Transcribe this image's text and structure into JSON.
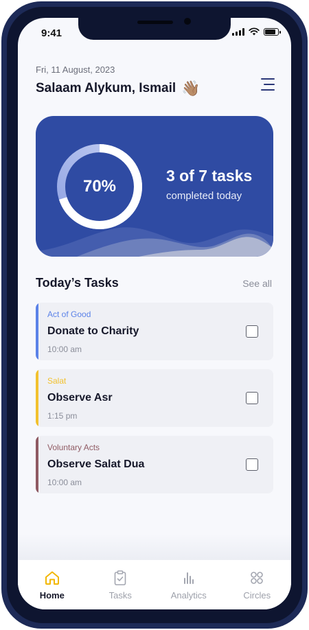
{
  "status": {
    "time": "9:41"
  },
  "header": {
    "date": "Fri, 11 August, 2023",
    "greeting": "Salaam Alykum, Ismail",
    "wave_emoji": "👋🏽",
    "menu_icon": "menu-icon"
  },
  "progress": {
    "percent_label": "70%",
    "fraction": 0.7,
    "title": "3 of 7 tasks",
    "subtitle": "completed today",
    "card_color": "#2f4ba3"
  },
  "tasks_section": {
    "title": "Today’s Tasks",
    "see_all": "See all"
  },
  "tasks": [
    {
      "category": "Act of Good",
      "name": "Donate to Charity",
      "time": "10:00 am",
      "accent": "#5b82e8",
      "checked": false
    },
    {
      "category": "Salat",
      "name": "Observe Asr",
      "time": "1:15 pm",
      "accent": "#f2c12e",
      "checked": false
    },
    {
      "category": "Voluntary Acts",
      "name": "Observe Salat Dua",
      "time": "10:00 am",
      "accent": "#8f5a63",
      "checked": false
    }
  ],
  "tabbar": {
    "active_color": "#f2b705",
    "items": [
      {
        "label": "Home",
        "icon": "home-icon",
        "active": true
      },
      {
        "label": "Tasks",
        "icon": "clipboard-icon",
        "active": false
      },
      {
        "label": "Analytics",
        "icon": "bar-chart-icon",
        "active": false
      },
      {
        "label": "Circles",
        "icon": "circles-icon",
        "active": false
      }
    ]
  }
}
